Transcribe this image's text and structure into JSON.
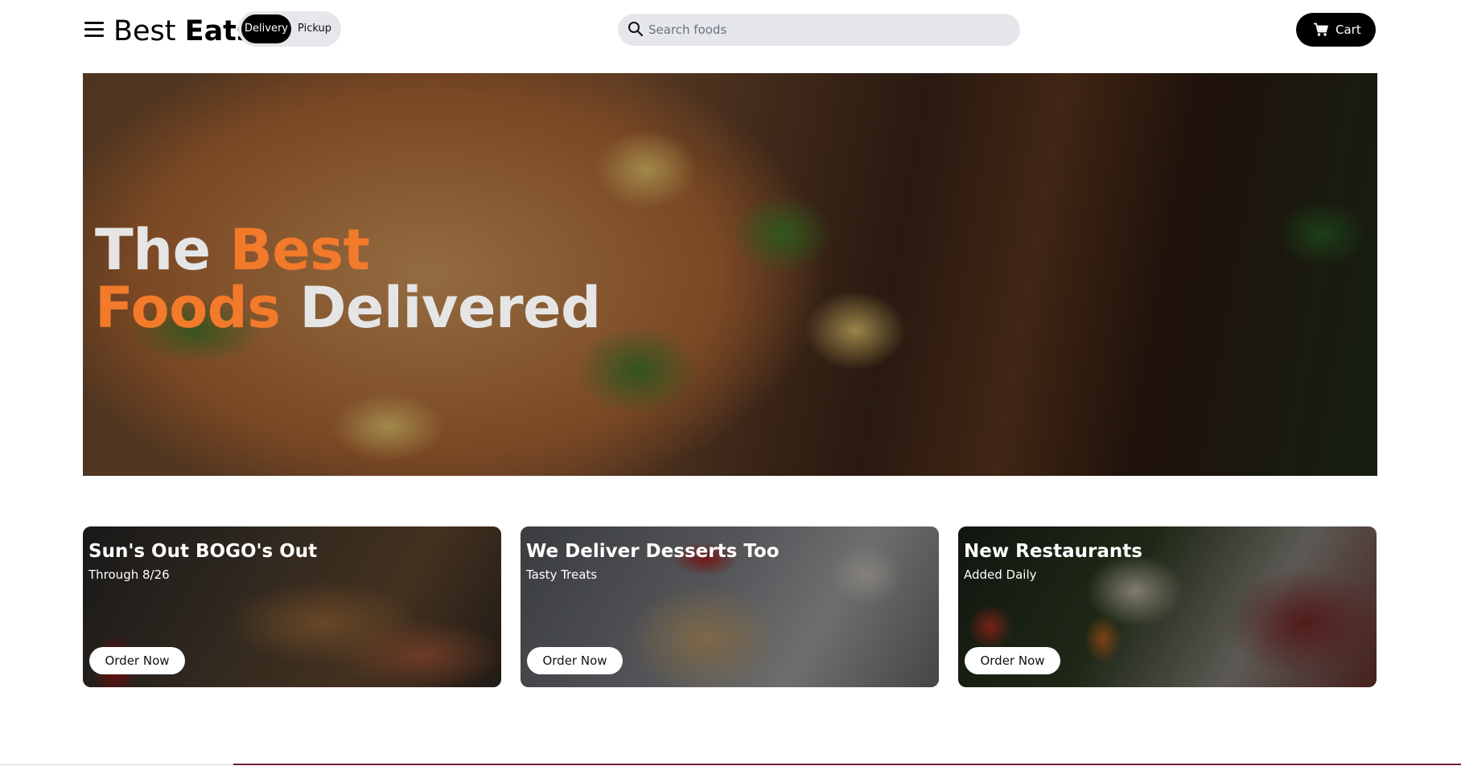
{
  "header": {
    "brand_light": "Best",
    "brand_bold": "Eats",
    "toggle": {
      "active": "Delivery",
      "inactive": "Pickup"
    },
    "search": {
      "placeholder": "Search foods",
      "value": ""
    },
    "cart_label": "Cart"
  },
  "hero": {
    "line1_white": "The",
    "line1_orange": "Best",
    "line2_orange": "Foods",
    "line2_white": "Delivered",
    "accent_color": "#f27a2a"
  },
  "promos": [
    {
      "title": "Sun's Out BOGO's Out",
      "subtitle": "Through 8/26",
      "button": "Order Now"
    },
    {
      "title": "We Deliver Desserts Too",
      "subtitle": "Tasty Treats",
      "button": "Order Now"
    },
    {
      "title": "New Restaurants",
      "subtitle": "Added Daily",
      "button": "Order Now"
    }
  ],
  "icons": {
    "menu": "hamburger-icon",
    "search": "search-icon",
    "cart": "cart-icon"
  }
}
